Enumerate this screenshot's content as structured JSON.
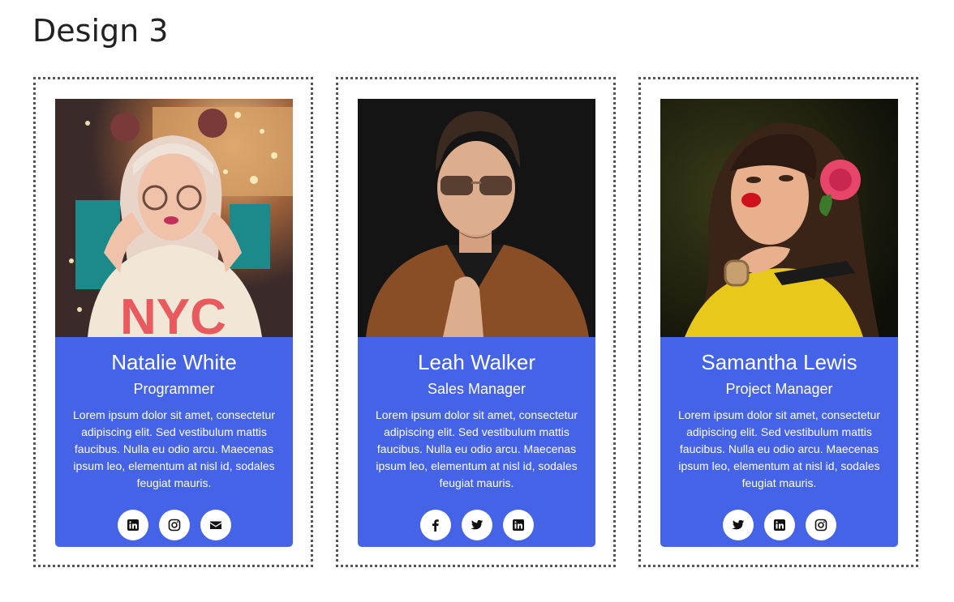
{
  "page": {
    "title": "Design 3"
  },
  "colors": {
    "card_background": "#4563e7",
    "card_text": "#ffffff",
    "icon_color": "#111111",
    "frame_border": "#555555"
  },
  "cards": [
    {
      "name": "Natalie White",
      "role": "Programmer",
      "bio": "Lorem ipsum dolor sit amet, consectetur adipiscing elit. Sed vestibulum mattis faucibus. Nulla eu odio arcu. Maecenas ipsum leo, elementum at nisl id, sodales feugiat mauris.",
      "photo_alt": "Woman with glasses",
      "socials": [
        "linkedin-icon",
        "instagram-icon",
        "envelope-icon"
      ]
    },
    {
      "name": "Leah Walker",
      "role": "Sales Manager",
      "bio": "Lorem ipsum dolor sit amet, consectetur adipiscing elit. Sed vestibulum mattis faucibus. Nulla eu odio arcu. Maecenas ipsum leo, elementum at nisl id, sodales feugiat mauris.",
      "photo_alt": "Man in sunglasses",
      "socials": [
        "facebook-icon",
        "twitter-icon",
        "linkedin-icon"
      ]
    },
    {
      "name": "Samantha Lewis",
      "role": "Project Manager",
      "bio": "Lorem ipsum dolor sit amet, consectetur adipiscing elit. Sed vestibulum mattis faucibus. Nulla eu odio arcu. Maecenas ipsum leo, elementum at nisl id, sodales feugiat mauris.",
      "photo_alt": "Woman with flower",
      "socials": [
        "twitter-icon",
        "linkedin-icon",
        "instagram-icon"
      ]
    }
  ]
}
